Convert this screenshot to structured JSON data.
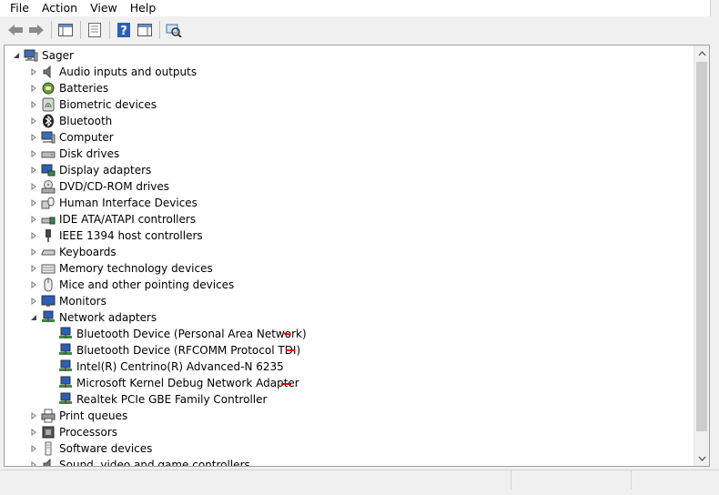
{
  "menubar": {
    "items": [
      "File",
      "Action",
      "View",
      "Help"
    ]
  },
  "toolbar": {
    "buttons": [
      "back-arrow-icon",
      "forward-arrow-icon",
      "console-tree-icon",
      "properties-icon",
      "help-icon",
      "action-pane-icon",
      "scan-hardware-icon"
    ]
  },
  "tree": {
    "root": "Sager",
    "categories": [
      "Audio inputs and outputs",
      "Batteries",
      "Biometric devices",
      "Bluetooth",
      "Computer",
      "Disk drives",
      "Display adapters",
      "DVD/CD-ROM drives",
      "Human Interface Devices",
      "IDE ATA/ATAPI controllers",
      "IEEE 1394 host controllers",
      "Keyboards",
      "Memory technology devices",
      "Mice and other pointing devices",
      "Monitors",
      "Network adapters"
    ],
    "network_adapters": [
      "Bluetooth Device (Personal Area Network)",
      "Bluetooth Device (RFCOMM Protocol TDI)",
      "Intel(R) Centrino(R) Advanced-N 6235",
      "Microsoft Kernel Debug Network Adapter",
      "Realtek PCIe GBE Family Controller"
    ],
    "after": [
      "Print queues",
      "Processors",
      "Software devices",
      "Sound, video and game controllers"
    ]
  },
  "colors": {
    "annotation": "#e00000",
    "selection": "#cce8ff"
  }
}
